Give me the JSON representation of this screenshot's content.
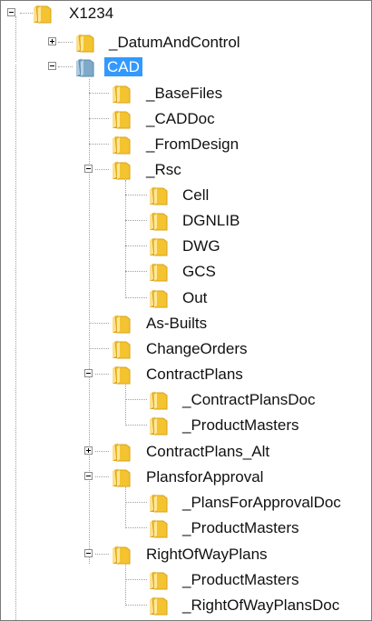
{
  "tree": {
    "nodes": [
      {
        "id": "x1234",
        "label": "X1234",
        "state": "expanded",
        "selected": false,
        "icon": "folder-icon",
        "color": "#f4c430"
      },
      {
        "id": "datumandcontrol",
        "label": "_DatumAndControl",
        "state": "collapsed",
        "selected": false,
        "icon": "folder-icon",
        "color": "#f4c430"
      },
      {
        "id": "cad",
        "label": "CAD",
        "state": "expanded",
        "selected": true,
        "icon": "folder-icon",
        "color": "#7fa9c9"
      },
      {
        "id": "basefiles",
        "label": "_BaseFiles",
        "state": "leaf",
        "selected": false,
        "icon": "folder-icon",
        "color": "#f4c430"
      },
      {
        "id": "caddoc",
        "label": "_CADDoc",
        "state": "leaf",
        "selected": false,
        "icon": "folder-icon",
        "color": "#f4c430"
      },
      {
        "id": "fromdesign",
        "label": "_FromDesign",
        "state": "leaf",
        "selected": false,
        "icon": "folder-icon",
        "color": "#f4c430"
      },
      {
        "id": "rsc",
        "label": "_Rsc",
        "state": "expanded",
        "selected": false,
        "icon": "folder-icon",
        "color": "#f4c430"
      },
      {
        "id": "cell",
        "label": "Cell",
        "state": "leaf",
        "selected": false,
        "icon": "folder-icon",
        "color": "#f4c430"
      },
      {
        "id": "dgnlib",
        "label": "DGNLIB",
        "state": "leaf",
        "selected": false,
        "icon": "folder-icon",
        "color": "#f4c430"
      },
      {
        "id": "dwg",
        "label": "DWG",
        "state": "leaf",
        "selected": false,
        "icon": "folder-icon",
        "color": "#f4c430"
      },
      {
        "id": "gcs",
        "label": "GCS",
        "state": "leaf",
        "selected": false,
        "icon": "folder-icon",
        "color": "#f4c430"
      },
      {
        "id": "out",
        "label": "Out",
        "state": "leaf",
        "selected": false,
        "icon": "folder-icon",
        "color": "#f4c430"
      },
      {
        "id": "as-builts",
        "label": "As-Builts",
        "state": "leaf",
        "selected": false,
        "icon": "folder-icon",
        "color": "#f4c430"
      },
      {
        "id": "changeorders",
        "label": "ChangeOrders",
        "state": "leaf",
        "selected": false,
        "icon": "folder-icon",
        "color": "#f4c430"
      },
      {
        "id": "contractplans",
        "label": "ContractPlans",
        "state": "expanded",
        "selected": false,
        "icon": "folder-icon",
        "color": "#f4c430"
      },
      {
        "id": "contractplansdoc",
        "label": "_ContractPlansDoc",
        "state": "leaf",
        "selected": false,
        "icon": "folder-icon",
        "color": "#f4c430"
      },
      {
        "id": "productmasters-1",
        "label": "_ProductMasters",
        "state": "leaf",
        "selected": false,
        "icon": "folder-icon",
        "color": "#f4c430"
      },
      {
        "id": "contractplans-alt",
        "label": "ContractPlans_Alt",
        "state": "collapsed",
        "selected": false,
        "icon": "folder-icon",
        "color": "#f4c430"
      },
      {
        "id": "plansforapproval",
        "label": "PlansforApproval",
        "state": "expanded",
        "selected": false,
        "icon": "folder-icon",
        "color": "#f4c430"
      },
      {
        "id": "plansforapprovaldoc",
        "label": "_PlansForApprovalDoc",
        "state": "leaf",
        "selected": false,
        "icon": "folder-icon",
        "color": "#f4c430"
      },
      {
        "id": "productmasters-2",
        "label": "_ProductMasters",
        "state": "leaf",
        "selected": false,
        "icon": "folder-icon",
        "color": "#f4c430"
      },
      {
        "id": "rightofwayplans",
        "label": "RightOfWayPlans",
        "state": "expanded",
        "selected": false,
        "icon": "folder-icon",
        "color": "#f4c430"
      },
      {
        "id": "productmasters-3",
        "label": "_ProductMasters",
        "state": "leaf",
        "selected": false,
        "icon": "folder-icon",
        "color": "#f4c430"
      },
      {
        "id": "rightofwayplansdoc",
        "label": "_RightOfWayPlansDoc",
        "state": "leaf",
        "selected": false,
        "icon": "folder-icon",
        "color": "#f4c430"
      }
    ]
  }
}
